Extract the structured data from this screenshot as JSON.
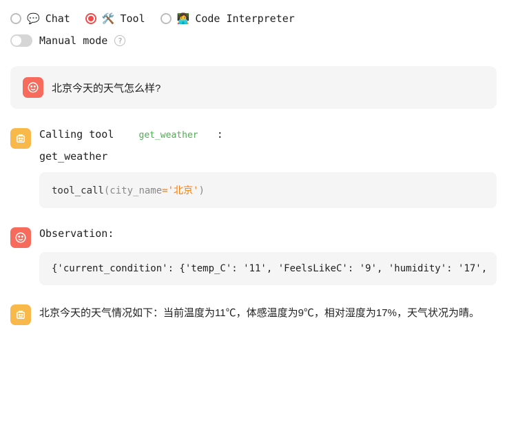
{
  "modes": {
    "chat": {
      "emoji": "💬",
      "label": "Chat"
    },
    "tool": {
      "emoji": "🛠️",
      "label": "Tool"
    },
    "code": {
      "emoji": "👩‍💻",
      "label": "Code Interpreter"
    },
    "selected": "tool"
  },
  "manual": {
    "label": "Manual mode",
    "enabled": false
  },
  "conversation": {
    "user_question": "北京今天的天气怎么样?",
    "tool_call": {
      "prefix": "Calling tool",
      "tool_name": "get_weather",
      "suffix": ":",
      "function_display": "get_weather",
      "code_fn": "tool_call",
      "code_kw": "city_name",
      "code_value": "'北京'"
    },
    "observation": {
      "title": "Observation:",
      "content": "{'current_condition': {'temp_C': '11', 'FeelsLikeC': '9', 'humidity': '17',"
    },
    "assistant_answer": "北京今天的天气情况如下：当前温度为11℃，体感温度为9℃，相对湿度为17%，天气状况为晴。"
  }
}
